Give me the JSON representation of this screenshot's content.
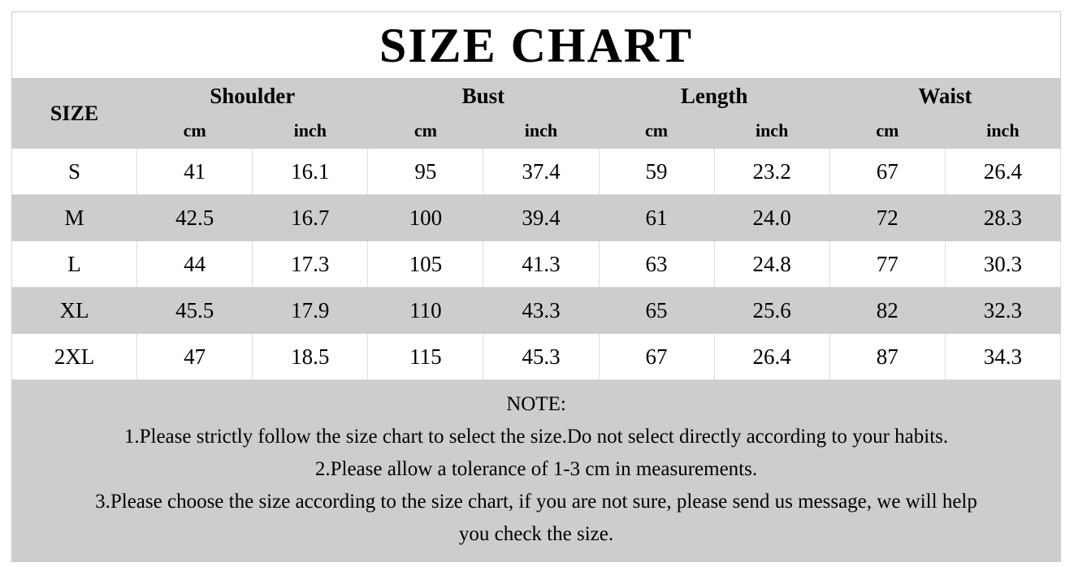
{
  "title": "SIZE CHART",
  "colors": {
    "band_gray": "#cdcdcd",
    "cell_white": "#ffffff",
    "grid_line": "#dcdcdc",
    "title_border": "#c9c9d2",
    "text": "#000000"
  },
  "table": {
    "size_header": "SIZE",
    "groups": [
      {
        "label": "Shoulder",
        "units": [
          "cm",
          "inch"
        ]
      },
      {
        "label": "Bust",
        "units": [
          "cm",
          "inch"
        ]
      },
      {
        "label": "Length",
        "units": [
          "cm",
          "inch"
        ]
      },
      {
        "label": "Waist",
        "units": [
          "cm",
          "inch"
        ]
      }
    ],
    "columns": [
      "SIZE",
      "Shoulder cm",
      "Shoulder inch",
      "Bust cm",
      "Bust inch",
      "Length cm",
      "Length inch",
      "Waist cm",
      "Waist inch"
    ],
    "rows": [
      {
        "size": "S",
        "shoulder_cm": "41",
        "shoulder_inch": "16.1",
        "bust_cm": "95",
        "bust_inch": "37.4",
        "length_cm": "59",
        "length_inch": "23.2",
        "waist_cm": "67",
        "waist_inch": "26.4"
      },
      {
        "size": "M",
        "shoulder_cm": "42.5",
        "shoulder_inch": "16.7",
        "bust_cm": "100",
        "bust_inch": "39.4",
        "length_cm": "61",
        "length_inch": "24.0",
        "waist_cm": "72",
        "waist_inch": "28.3"
      },
      {
        "size": "L",
        "shoulder_cm": "44",
        "shoulder_inch": "17.3",
        "bust_cm": "105",
        "bust_inch": "41.3",
        "length_cm": "63",
        "length_inch": "24.8",
        "waist_cm": "77",
        "waist_inch": "30.3"
      },
      {
        "size": "XL",
        "shoulder_cm": "45.5",
        "shoulder_inch": "17.9",
        "bust_cm": "110",
        "bust_inch": "43.3",
        "length_cm": "65",
        "length_inch": "25.6",
        "waist_cm": "82",
        "waist_inch": "32.3"
      },
      {
        "size": "2XL",
        "shoulder_cm": "47",
        "shoulder_inch": "18.5",
        "bust_cm": "115",
        "bust_inch": "45.3",
        "length_cm": "67",
        "length_inch": "26.4",
        "waist_cm": "87",
        "waist_inch": "34.3"
      }
    ]
  },
  "note": {
    "heading": "NOTE:",
    "lines": [
      "1.Please strictly follow the size chart to select the size.Do not select directly according to your habits.",
      "2.Please allow a tolerance of 1-3 cm in measurements.",
      "3.Please choose the size according to the size chart, if you are not sure, please send us message, we will help",
      "you check the size."
    ]
  }
}
